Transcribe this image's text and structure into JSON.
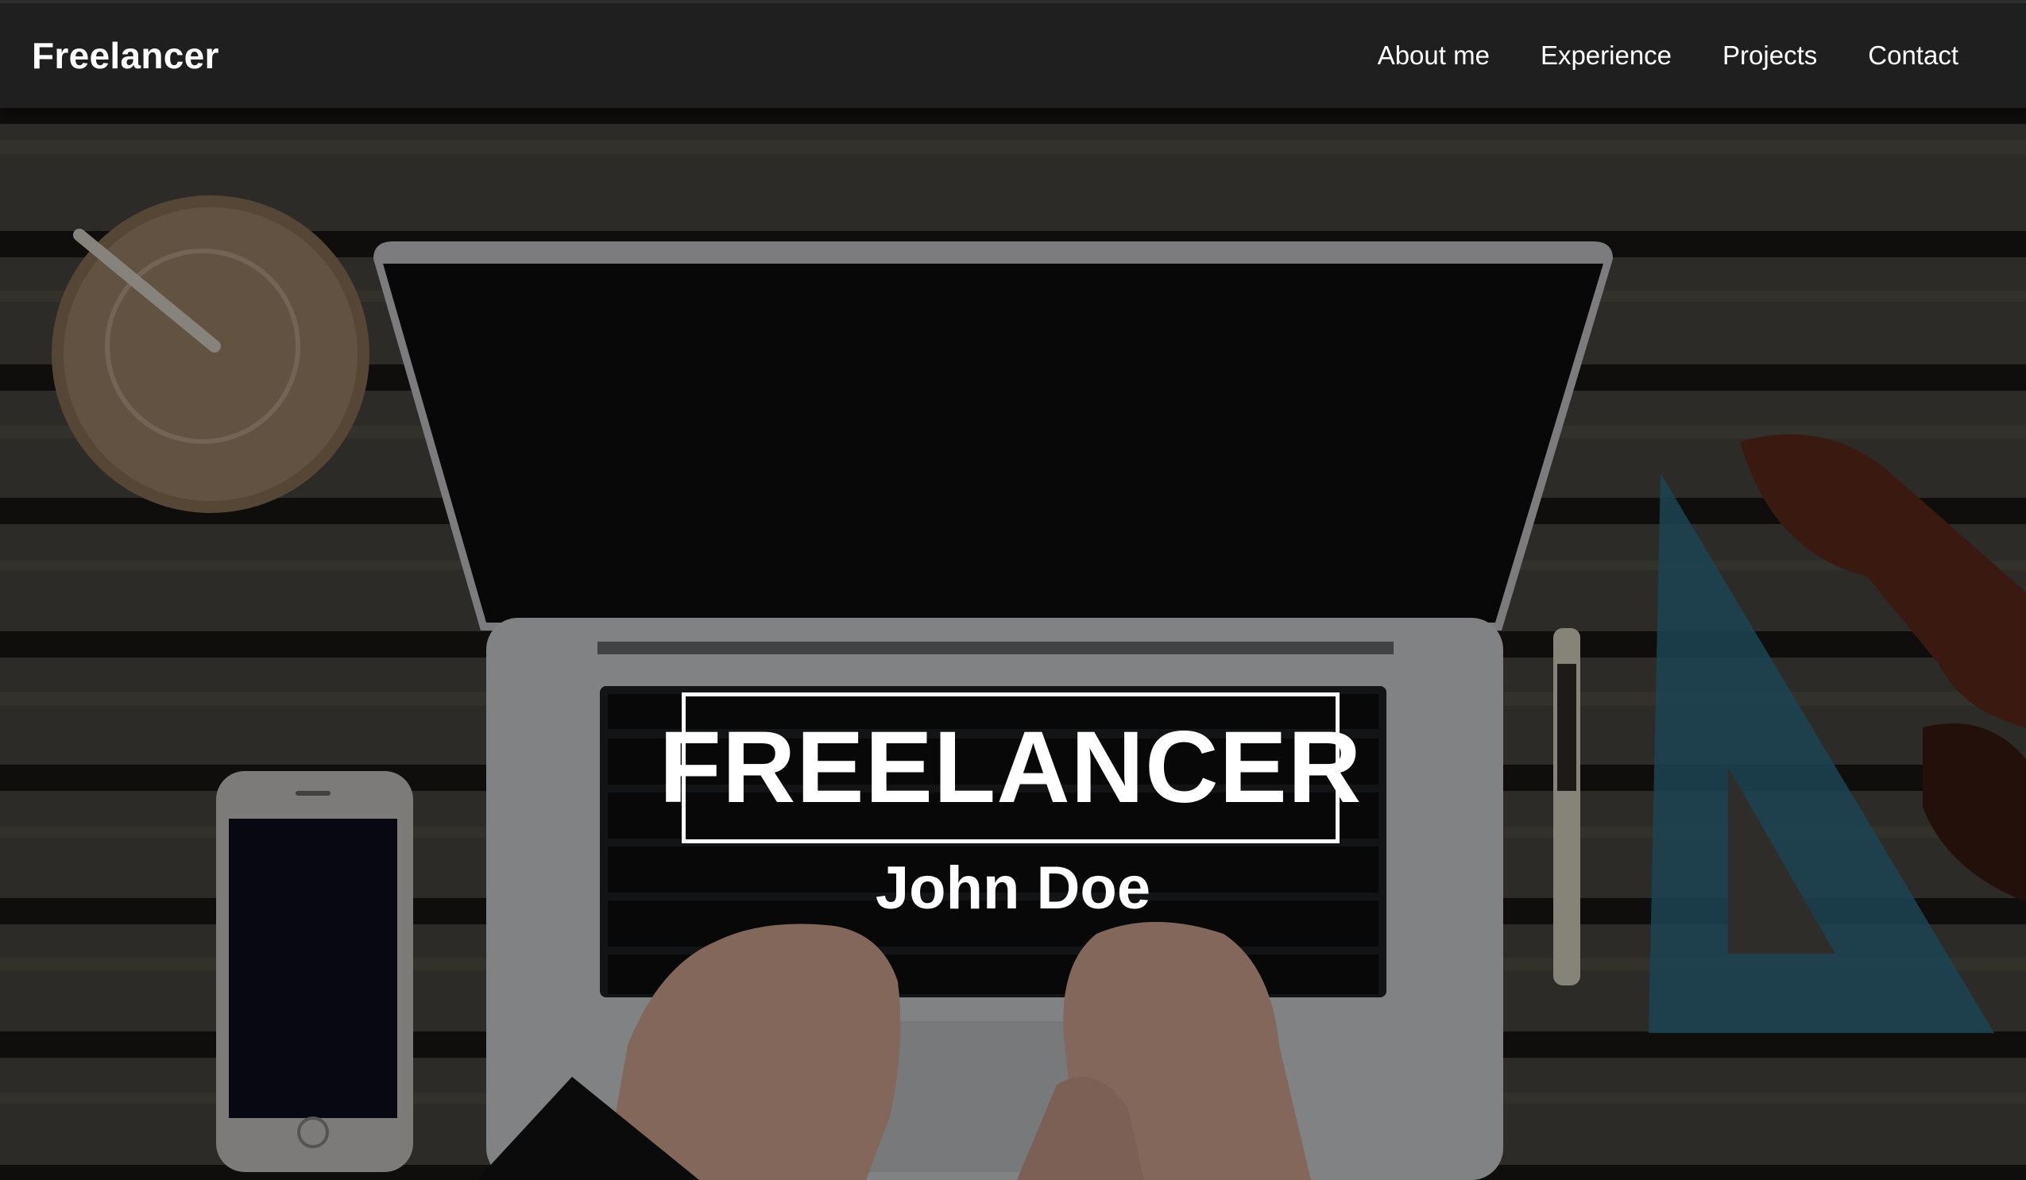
{
  "navbar": {
    "brand": "Freelancer",
    "links": [
      "About me",
      "Experience",
      "Projects",
      "Contact"
    ]
  },
  "hero": {
    "title": "FREELANCER",
    "subtitle": "John Doe",
    "background_image": "laptop-on-wooden-table-photo"
  },
  "colors": {
    "navbar_bg": "#1f1f1f",
    "text": "#ffffff"
  }
}
